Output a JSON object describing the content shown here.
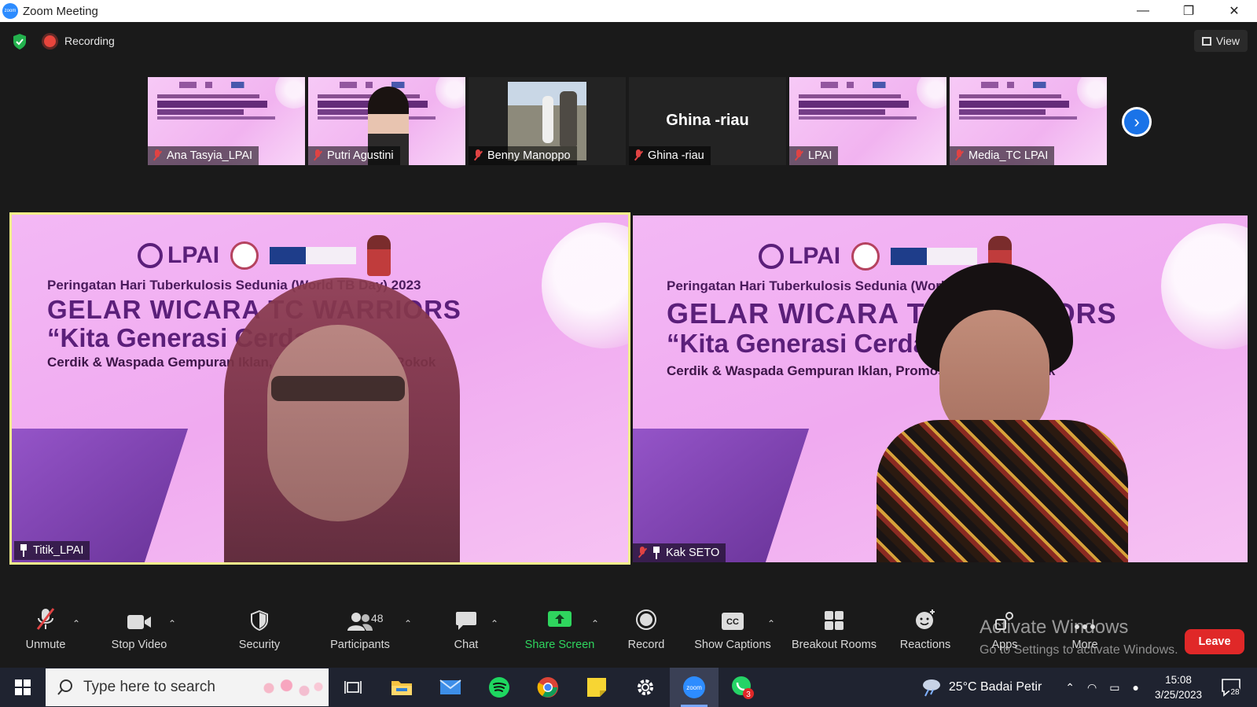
{
  "window": {
    "title": "Zoom Meeting",
    "minimize": "—",
    "maximize": "❐",
    "close": "✕"
  },
  "topbar": {
    "recording_label": "Recording",
    "view_label": "View"
  },
  "thumbnails": [
    {
      "name": "Ana Tasyia_LPAI"
    },
    {
      "name": "Putri Agustini"
    },
    {
      "name": "Benny Manoppo"
    },
    {
      "name": "Ghina -riau",
      "display_name": "Ghina -riau"
    },
    {
      "name": "LPAI"
    },
    {
      "name": "Media_TC LPAI"
    }
  ],
  "tiles": {
    "left": {
      "name": "Titik_LPAI"
    },
    "right": {
      "name": "Kak SETO"
    }
  },
  "slide": {
    "org": "LPAI",
    "line1": "Peringatan Hari Tuberkulosis Sedunia (World TB Day) 2023",
    "line2": "GELAR WICARA TC WARRIORS",
    "line3": "“Kita Generasi Cerdas”",
    "line4": "Cerdik & Waspada Gempuran Iklan, Promosi, Sponsor Rokok"
  },
  "toolbar": {
    "unmute": "Unmute",
    "stop_video": "Stop Video",
    "security": "Security",
    "participants": "Participants",
    "participants_count": "48",
    "chat": "Chat",
    "share_screen": "Share Screen",
    "record": "Record",
    "show_captions": "Show Captions",
    "breakout_rooms": "Breakout Rooms",
    "reactions": "Reactions",
    "apps": "Apps",
    "more": "More",
    "leave": "Leave"
  },
  "watermark": {
    "line1": "Activate Windows",
    "line2": "Go to Settings to activate Windows."
  },
  "taskbar": {
    "search_placeholder": "Type here to search",
    "whatsapp_badge": "3",
    "weather": "25°C  Badai Petir",
    "time": "15:08",
    "date": "3/25/2023",
    "notification_count": "28"
  },
  "colors": {
    "accent_blue": "#1a73e8",
    "share_green": "#2fd55e",
    "leave_red": "#e02828",
    "active_speaker": "#f5f28c"
  }
}
